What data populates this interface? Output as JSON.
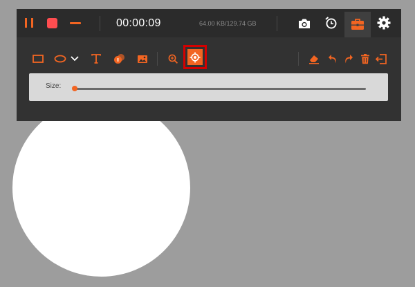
{
  "recorder": {
    "timer": "00:00:09",
    "file_size": "64.00 KB/129.74 GB"
  },
  "toolbar": {
    "size_label": "Size:",
    "size_value_fraction": 0.0,
    "selected_tool": "spotlight-tool",
    "active_tab": "toolbox"
  },
  "colors": {
    "accent": "#f26522",
    "panel": "#323232",
    "topbar": "#2b2b2b",
    "highlight_border": "#d50000",
    "size_box": "#d9d9d9",
    "background": "#9d9d9d"
  },
  "icons": [
    "pause-icon",
    "stop-icon",
    "minimize-icon",
    "camera-icon",
    "alarm-clock-icon",
    "toolbox-icon",
    "gear-icon",
    "rectangle-icon",
    "ellipse-icon",
    "chevron-down-icon",
    "text-icon",
    "numbered-step-icon",
    "image-icon",
    "zoom-in-icon",
    "spotlight-icon",
    "eraser-icon",
    "undo-icon",
    "redo-icon",
    "trash-icon",
    "exit-icon"
  ]
}
